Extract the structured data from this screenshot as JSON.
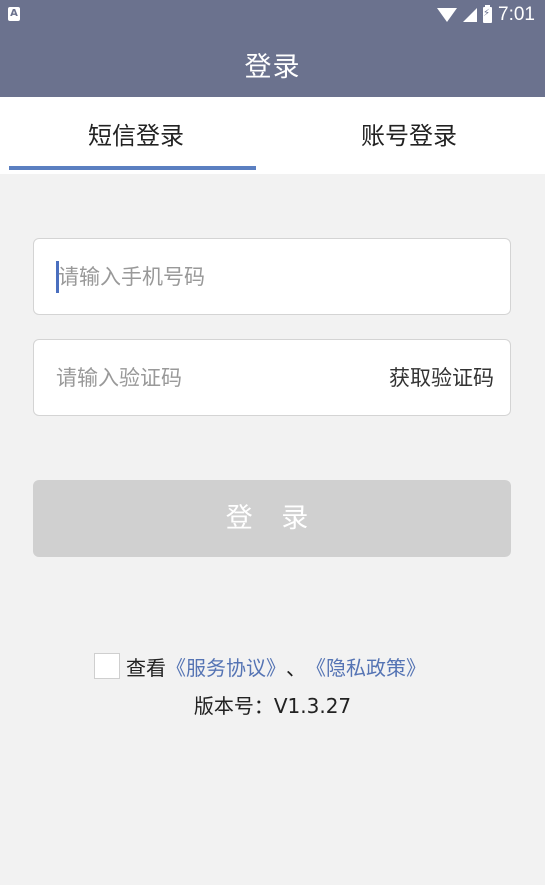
{
  "status": {
    "time": "7:01",
    "left_icon": "A"
  },
  "header": {
    "title": "登录"
  },
  "tabs": [
    {
      "label": "短信登录",
      "active": true
    },
    {
      "label": "账号登录",
      "active": false
    }
  ],
  "form": {
    "phone_placeholder": "请输入手机号码",
    "code_placeholder": "请输入验证码",
    "get_code_label": "获取验证码",
    "login_label": "登 录"
  },
  "agreement": {
    "prefix": "查看",
    "service_link": "《服务协议》",
    "separator": "、",
    "privacy_link": "《隐私政策》",
    "checked": false
  },
  "version": "版本号：V1.3.27",
  "colors": {
    "header": "#6b728e",
    "accent": "#5b7fc1",
    "link": "#5574b4",
    "button_disabled": "#d0d0d0"
  }
}
